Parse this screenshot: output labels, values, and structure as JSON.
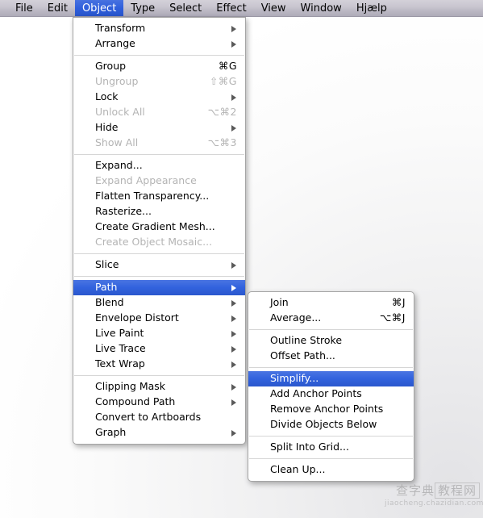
{
  "menubar": {
    "items": [
      {
        "label": "File",
        "active": false
      },
      {
        "label": "Edit",
        "active": false
      },
      {
        "label": "Object",
        "active": true
      },
      {
        "label": "Type",
        "active": false
      },
      {
        "label": "Select",
        "active": false
      },
      {
        "label": "Effect",
        "active": false
      },
      {
        "label": "View",
        "active": false
      },
      {
        "label": "Window",
        "active": false
      },
      {
        "label": "Hjælp",
        "active": false
      }
    ]
  },
  "object_menu": {
    "title": "Object",
    "groups": [
      [
        {
          "label": "Transform",
          "shortcut": "",
          "arrow": true,
          "disabled": false,
          "selected": false
        },
        {
          "label": "Arrange",
          "shortcut": "",
          "arrow": true,
          "disabled": false,
          "selected": false
        }
      ],
      [
        {
          "label": "Group",
          "shortcut": "⌘G",
          "arrow": false,
          "disabled": false,
          "selected": false
        },
        {
          "label": "Ungroup",
          "shortcut": "⇧⌘G",
          "arrow": false,
          "disabled": true,
          "selected": false
        },
        {
          "label": "Lock",
          "shortcut": "",
          "arrow": true,
          "disabled": false,
          "selected": false
        },
        {
          "label": "Unlock All",
          "shortcut": "⌥⌘2",
          "arrow": false,
          "disabled": true,
          "selected": false
        },
        {
          "label": "Hide",
          "shortcut": "",
          "arrow": true,
          "disabled": false,
          "selected": false
        },
        {
          "label": "Show All",
          "shortcut": "⌥⌘3",
          "arrow": false,
          "disabled": true,
          "selected": false
        }
      ],
      [
        {
          "label": "Expand...",
          "shortcut": "",
          "arrow": false,
          "disabled": false,
          "selected": false
        },
        {
          "label": "Expand Appearance",
          "shortcut": "",
          "arrow": false,
          "disabled": true,
          "selected": false
        },
        {
          "label": "Flatten Transparency...",
          "shortcut": "",
          "arrow": false,
          "disabled": false,
          "selected": false
        },
        {
          "label": "Rasterize...",
          "shortcut": "",
          "arrow": false,
          "disabled": false,
          "selected": false
        },
        {
          "label": "Create Gradient Mesh...",
          "shortcut": "",
          "arrow": false,
          "disabled": false,
          "selected": false
        },
        {
          "label": "Create Object Mosaic...",
          "shortcut": "",
          "arrow": false,
          "disabled": true,
          "selected": false
        }
      ],
      [
        {
          "label": "Slice",
          "shortcut": "",
          "arrow": true,
          "disabled": false,
          "selected": false
        }
      ],
      [
        {
          "label": "Path",
          "shortcut": "",
          "arrow": true,
          "disabled": false,
          "selected": true
        },
        {
          "label": "Blend",
          "shortcut": "",
          "arrow": true,
          "disabled": false,
          "selected": false
        },
        {
          "label": "Envelope Distort",
          "shortcut": "",
          "arrow": true,
          "disabled": false,
          "selected": false
        },
        {
          "label": "Live Paint",
          "shortcut": "",
          "arrow": true,
          "disabled": false,
          "selected": false
        },
        {
          "label": "Live Trace",
          "shortcut": "",
          "arrow": true,
          "disabled": false,
          "selected": false
        },
        {
          "label": "Text Wrap",
          "shortcut": "",
          "arrow": true,
          "disabled": false,
          "selected": false
        }
      ],
      [
        {
          "label": "Clipping Mask",
          "shortcut": "",
          "arrow": true,
          "disabled": false,
          "selected": false
        },
        {
          "label": "Compound Path",
          "shortcut": "",
          "arrow": true,
          "disabled": false,
          "selected": false
        },
        {
          "label": "Convert to Artboards",
          "shortcut": "",
          "arrow": false,
          "disabled": false,
          "selected": false
        },
        {
          "label": "Graph",
          "shortcut": "",
          "arrow": true,
          "disabled": false,
          "selected": false
        }
      ]
    ]
  },
  "path_submenu": {
    "title": "Path",
    "groups": [
      [
        {
          "label": "Join",
          "shortcut": "⌘J",
          "arrow": false,
          "disabled": false,
          "selected": false
        },
        {
          "label": "Average...",
          "shortcut": "⌥⌘J",
          "arrow": false,
          "disabled": false,
          "selected": false
        }
      ],
      [
        {
          "label": "Outline Stroke",
          "shortcut": "",
          "arrow": false,
          "disabled": false,
          "selected": false
        },
        {
          "label": "Offset Path...",
          "shortcut": "",
          "arrow": false,
          "disabled": false,
          "selected": false
        }
      ],
      [
        {
          "label": "Simplify...",
          "shortcut": "",
          "arrow": false,
          "disabled": false,
          "selected": true
        },
        {
          "label": "Add Anchor Points",
          "shortcut": "",
          "arrow": false,
          "disabled": false,
          "selected": false
        },
        {
          "label": "Remove Anchor Points",
          "shortcut": "",
          "arrow": false,
          "disabled": false,
          "selected": false
        },
        {
          "label": "Divide Objects Below",
          "shortcut": "",
          "arrow": false,
          "disabled": false,
          "selected": false
        }
      ],
      [
        {
          "label": "Split Into Grid...",
          "shortcut": "",
          "arrow": false,
          "disabled": false,
          "selected": false
        }
      ],
      [
        {
          "label": "Clean Up...",
          "shortcut": "",
          "arrow": false,
          "disabled": false,
          "selected": false
        }
      ]
    ]
  },
  "watermark": {
    "cn_left": "查字典",
    "cn_box": "教程网",
    "url": "jiaocheng.chazidian.com"
  },
  "colors": {
    "highlight_blue": "#2f5fdc",
    "menu_bg": "#ffffff",
    "menubar_top": "#d4d1d9",
    "menubar_bottom": "#aeabb8",
    "disabled_text": "#b4b4b4",
    "separator": "#d6d6d6"
  }
}
